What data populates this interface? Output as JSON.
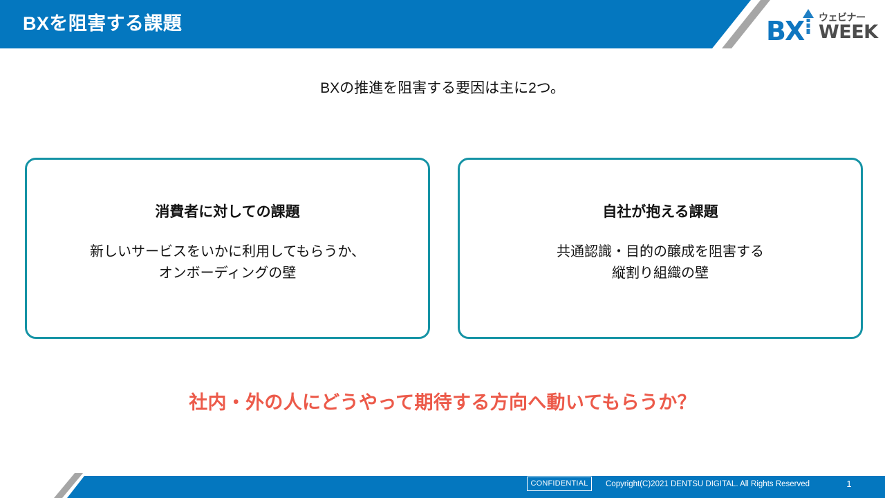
{
  "header": {
    "title": "BXを阻害する課題",
    "band_color": "#0477bf",
    "stripe_color": "#a6a6a6"
  },
  "logo": {
    "mark": "BX",
    "kana": "ウェビナー",
    "word": "WEEK",
    "mark_color": "#0f76c0",
    "word_color": "#4d4d4d"
  },
  "main": {
    "lead": "BXの推進を阻害する要因は主に2つ。",
    "cards": [
      {
        "title": "消費者に対しての課題",
        "body": "新しいサービスをいかに利用してもらうか、\nオンボーディングの壁"
      },
      {
        "title": "自社が抱える課題",
        "body": "共通認識・目的の醸成を阻害する\n縦割り組織の壁"
      }
    ],
    "highlight": "社内・外の人にどうやって期待する方向へ動いてもらうか？",
    "highlight_color": "#ec5a4a",
    "card_border_color": "#1593a5"
  },
  "footer": {
    "confidential": "CONFIDENTIAL",
    "copyright": "Copyright(C)2021 DENTSU DIGITAL. All Rights Reserved",
    "page_number": "1"
  }
}
